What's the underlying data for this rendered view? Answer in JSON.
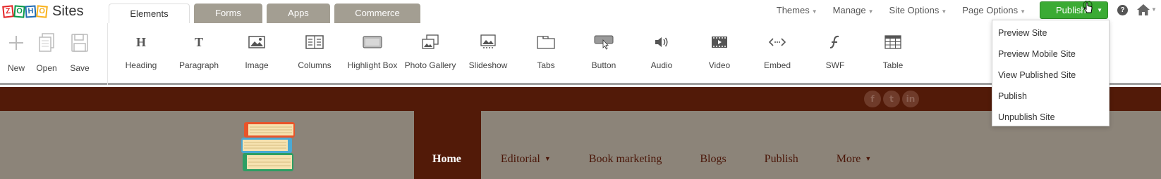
{
  "app": {
    "logo_letters": [
      "Z",
      "O",
      "H",
      "O"
    ],
    "logo_text": "Sites"
  },
  "tabs": [
    {
      "label": "Elements",
      "active": true
    },
    {
      "label": "Forms",
      "active": false
    },
    {
      "label": "Apps",
      "active": false
    },
    {
      "label": "Commerce",
      "active": false
    }
  ],
  "topnav": {
    "themes": "Themes",
    "manage": "Manage",
    "site_options": "Site Options",
    "page_options": "Page Options",
    "publish": "Publish",
    "help_glyph": "?"
  },
  "file_tools": [
    {
      "label": "New",
      "icon": "plus-icon"
    },
    {
      "label": "Open",
      "icon": "open-document-icon"
    },
    {
      "label": "Save",
      "icon": "floppy-disk-icon"
    }
  ],
  "elements": [
    {
      "label": "Heading",
      "icon": "heading-icon"
    },
    {
      "label": "Paragraph",
      "icon": "paragraph-icon"
    },
    {
      "label": "Image",
      "icon": "image-icon"
    },
    {
      "label": "Columns",
      "icon": "columns-icon"
    },
    {
      "label": "Highlight Box",
      "icon": "highlight-box-icon"
    },
    {
      "label": "Photo Gallery",
      "icon": "photo-gallery-icon"
    },
    {
      "label": "Slideshow",
      "icon": "slideshow-icon"
    },
    {
      "label": "Tabs",
      "icon": "tabs-icon"
    },
    {
      "label": "Button",
      "icon": "button-icon"
    },
    {
      "label": "Audio",
      "icon": "audio-icon"
    },
    {
      "label": "Video",
      "icon": "video-icon"
    },
    {
      "label": "Embed",
      "icon": "embed-icon"
    },
    {
      "label": "SWF",
      "icon": "swf-icon"
    },
    {
      "label": "Table",
      "icon": "table-icon"
    }
  ],
  "publish_menu": [
    "Preview Site",
    "Preview Mobile Site",
    "View Published Site",
    "Publish",
    "Unpublish Site"
  ],
  "site": {
    "social": [
      "f",
      "t",
      "in"
    ],
    "nav": [
      {
        "label": "Home",
        "active": true,
        "dropdown": false
      },
      {
        "label": "Editorial",
        "active": false,
        "dropdown": true
      },
      {
        "label": "Book marketing",
        "active": false,
        "dropdown": false
      },
      {
        "label": "Blogs",
        "active": false,
        "dropdown": false
      },
      {
        "label": "Publish",
        "active": false,
        "dropdown": false
      },
      {
        "label": "More",
        "active": false,
        "dropdown": true
      }
    ]
  },
  "colors": {
    "publish_green": "#3bab34",
    "site_maroon": "#521a08",
    "site_header_bg": "#8c8479",
    "inactive_tab": "#a39e92"
  }
}
